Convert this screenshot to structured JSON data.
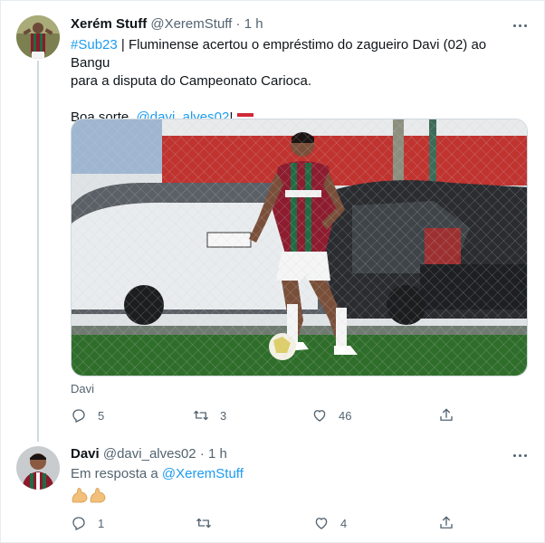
{
  "tweet1": {
    "name": "Xerém Stuff",
    "handle": "@XeremStuff",
    "separator": "·",
    "time": "1 h",
    "hashtag": "#Sub23",
    "text_line1": " | Fluminense acertou o empréstimo do zagueiro Davi (02) ao Bangu",
    "text_line2": "para a disputa do Campeonato Carioca.",
    "text_line3_prefix": "Boa sorte, ",
    "mention": "@davi_alves02",
    "text_line3_suffix": "!",
    "flag_icon": "hungary-flag-emoji",
    "media_caption": "Davi",
    "actions": {
      "replies": "5",
      "retweets": "3",
      "likes": "46"
    }
  },
  "tweet2": {
    "name": "Davi",
    "handle": "@davi_alves02",
    "separator": "·",
    "time": "1 h",
    "reply_prefix": "Em resposta a ",
    "reply_to": "@XeremStuff",
    "emoji": "flexed-biceps-emoji-x2",
    "actions": {
      "replies": "1",
      "retweets": "",
      "likes": "4"
    }
  },
  "colors": {
    "link": "#1d9bf0",
    "muted": "#536471",
    "text": "#0f1419",
    "thread_line": "#cfd9de"
  }
}
